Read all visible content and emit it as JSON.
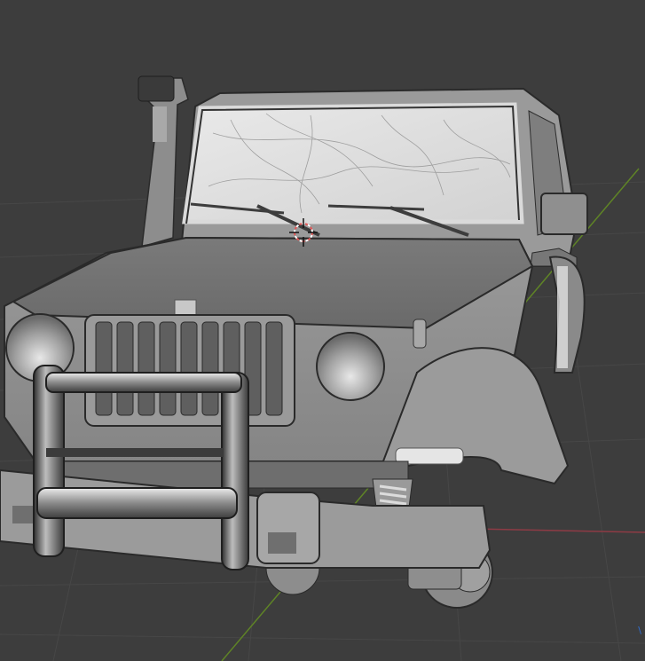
{
  "viewport": {
    "background_color": "#3d3d3d",
    "grid_color": "#4a4a4a",
    "x_axis_color": "#9e3b46",
    "y_axis_color": "#6b8f2a",
    "corner_axis_label": "\\",
    "cursor_icon": "3d-cursor-icon"
  },
  "model": {
    "object": "offroad-jeep-mesh",
    "body_color": "#8c8c8c",
    "chrome_color": "#b9b9b9"
  }
}
